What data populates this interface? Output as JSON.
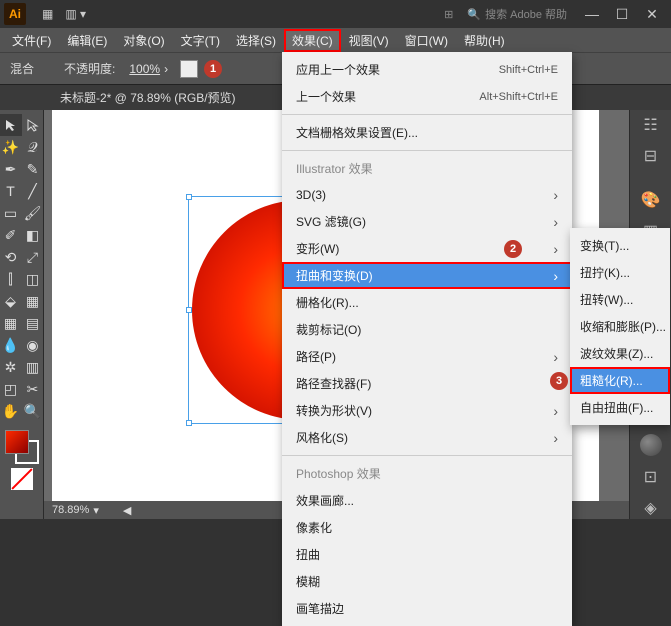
{
  "titlebar": {
    "logo": "Ai",
    "search_placeholder": "搜索 Adobe 帮助"
  },
  "menubar": {
    "file": "文件(F)",
    "edit": "编辑(E)",
    "object": "对象(O)",
    "type": "文字(T)",
    "select": "选择(S)",
    "effect": "效果(C)",
    "view": "视图(V)",
    "window": "窗口(W)",
    "help": "帮助(H)"
  },
  "optionsbar": {
    "blend": "混合",
    "opacity_label": "不透明度:",
    "opacity_value": "100%",
    "marker1": "1"
  },
  "doc": {
    "title": "未标题-2* @ 78.89% (RGB/预览)"
  },
  "status": {
    "zoom": "78.89%"
  },
  "effects_menu": {
    "apply_last": "应用上一个效果",
    "apply_last_sc": "Shift+Ctrl+E",
    "last_effect": "上一个效果",
    "last_effect_sc": "Alt+Shift+Ctrl+E",
    "raster_settings": "文档栅格效果设置(E)...",
    "header_ai": "Illustrator 效果",
    "three_d": "3D(3)",
    "svg_filters": "SVG 滤镜(G)",
    "warp": "变形(W)",
    "distort_transform": "扭曲和变换(D)",
    "rasterize": "栅格化(R)...",
    "crop_marks": "裁剪标记(O)",
    "path": "路径(P)",
    "pathfinder": "路径查找器(F)",
    "convert_shape": "转换为形状(V)",
    "stylize": "风格化(S)",
    "header_ps": "Photoshop 效果",
    "gallery": "效果画廊...",
    "pixelate": "像素化",
    "distort": "扭曲",
    "blur": "模糊",
    "brush": "画笔描边",
    "marker2": "2"
  },
  "distort_submenu": {
    "transform": "变换(T)...",
    "pucker": "扭拧(K)...",
    "twist": "扭转(W)...",
    "shrink": "收缩和膨胀(P)...",
    "zigzag": "波纹效果(Z)...",
    "roughen": "粗糙化(R)...",
    "free": "自由扭曲(F)...",
    "marker3": "3"
  }
}
